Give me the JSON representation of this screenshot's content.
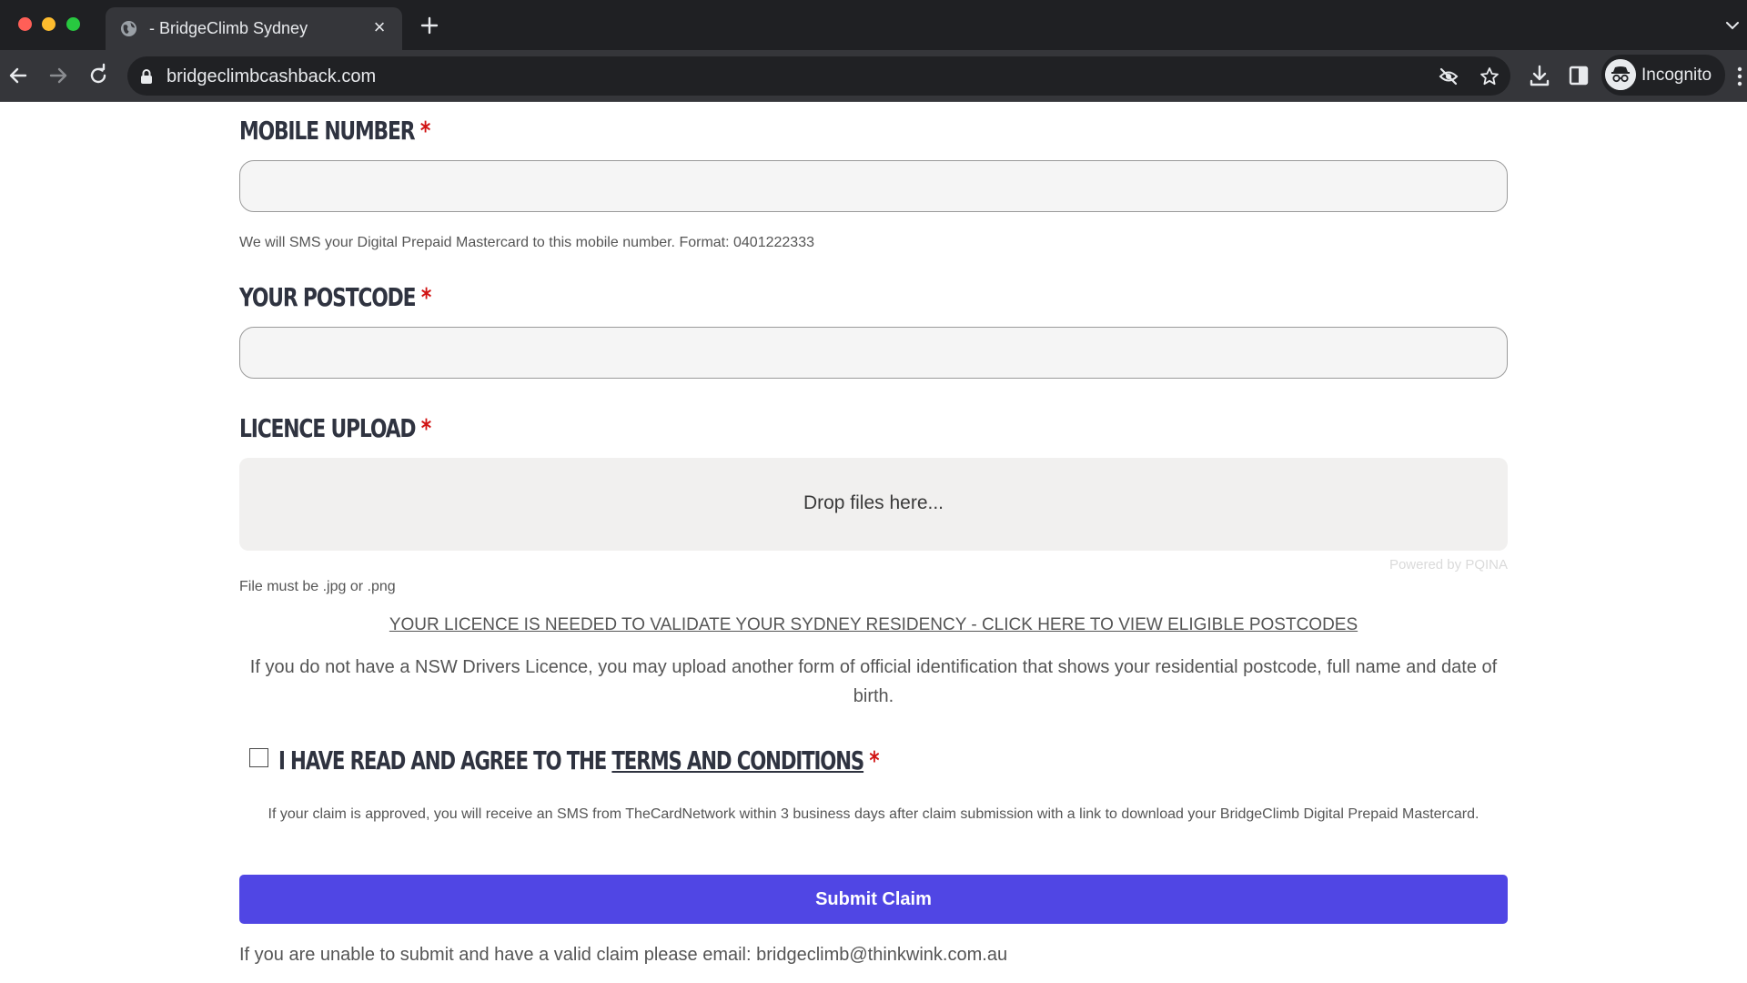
{
  "browser": {
    "tab_title": "- BridgeClimb Sydney",
    "tab_close": "×",
    "url": "bridgeclimbcashback.com",
    "profile_label": "Incognito"
  },
  "form": {
    "mobile": {
      "label": "MOBILE NUMBER",
      "required_mark": "*",
      "value": "",
      "help": "We will SMS your Digital Prepaid Mastercard to this mobile number. Format: 0401222333"
    },
    "postcode": {
      "label": "YOUR POSTCODE",
      "required_mark": "*",
      "value": ""
    },
    "licence": {
      "label": "LICENCE UPLOAD",
      "required_mark": "*",
      "drop_text": "Drop files here...",
      "powered_by": "Powered by PQINA",
      "help": "File must be .jpg or .png"
    },
    "residency_link": "YOUR LICENCE IS NEEDED TO VALIDATE YOUR SYDNEY RESIDENCY - CLICK HERE TO VIEW ELIGIBLE POSTCODES",
    "id_note": "If you do not have a NSW Drivers Licence, you may upload another form of official identification that shows your residential postcode, full name and date of birth.",
    "terms": {
      "checked": false,
      "label_prefix": "I HAVE READ AND AGREE TO THE",
      "link_text": "TERMS AND CONDITIONS",
      "required_mark": "*"
    },
    "sms_note": "If your claim is approved, you will receive an SMS from TheCardNetwork within 3 business days after claim submission with a link to download your BridgeClimb Digital Prepaid Mastercard.",
    "submit_label": "Submit Claim",
    "footer_note": "If you are unable to submit and have a valid claim please email: bridgeclimb@thinkwink.com.au"
  },
  "colors": {
    "submit_bg": "#5046e4",
    "required": "#d11414",
    "label": "#2f3340"
  },
  "icons": {
    "tab": "globe-icon",
    "new_tab": "plus-icon",
    "back": "arrow-left-icon",
    "forward": "arrow-right-icon",
    "reload": "reload-icon",
    "lock": "lock-icon",
    "tracking": "eye-off-icon",
    "bookmark": "star-icon",
    "download": "download-icon",
    "side_panel": "side-panel-icon",
    "incognito": "incognito-icon",
    "menu": "kebab-menu-icon"
  }
}
